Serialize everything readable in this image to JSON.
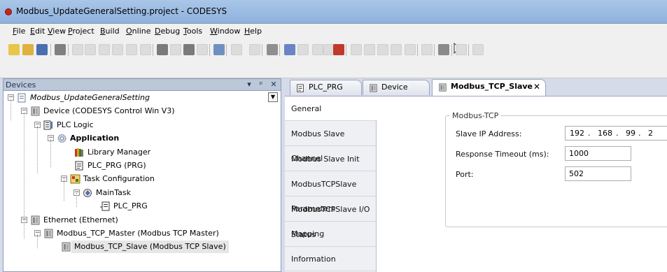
{
  "window": {
    "title": "Modbus_UpdateGeneralSetting.project - CODESYS",
    "accent": "#8fb1dc"
  },
  "menu": [
    {
      "label": "File",
      "u": "F",
      "rest": "ile"
    },
    {
      "label": "Edit",
      "u": "E",
      "rest": "dit"
    },
    {
      "label": "View",
      "u": "V",
      "rest": "iew"
    },
    {
      "label": "Project",
      "u": "P",
      "rest": "roject"
    },
    {
      "label": "Build",
      "u": "B",
      "rest": "uild"
    },
    {
      "label": "Online",
      "u": "O",
      "rest": "nline"
    },
    {
      "label": "Debug",
      "u": "D",
      "rest": "ebug"
    },
    {
      "label": "Tools",
      "u": "T",
      "rest": "ools"
    },
    {
      "label": "Window",
      "u": "W",
      "rest": "indow"
    },
    {
      "label": "Help",
      "u": "H",
      "rest": "elp"
    }
  ],
  "devices": {
    "title": "Devices",
    "pin_glyph": "▾",
    "tack_glyph": "ᵖ",
    "close_glyph": "✕",
    "tree": [
      {
        "label": "Modbus_UpdateGeneralSetting",
        "italic": true,
        "icon": "project-icon"
      },
      {
        "label": "Device (CODESYS Control Win V3)",
        "icon": "device-icon"
      },
      {
        "label": "PLC Logic",
        "icon": "plc-logic-icon"
      },
      {
        "label": "Application",
        "bold": true,
        "icon": "application-gear-icon"
      },
      {
        "label": "Library Manager",
        "icon": "library-books-icon"
      },
      {
        "label": "PLC_PRG (PRG)",
        "icon": "program-icon"
      },
      {
        "label": "Task Configuration",
        "icon": "task-config-icon"
      },
      {
        "label": "MainTask",
        "icon": "task-icon"
      },
      {
        "label": "PLC_PRG",
        "icon": "program-call-icon"
      },
      {
        "label": "Ethernet (Ethernet)",
        "icon": "device-icon"
      },
      {
        "label": "Modbus_TCP_Master (Modbus TCP Master)",
        "icon": "device-icon"
      },
      {
        "label": "Modbus_TCP_Slave (Modbus TCP Slave)",
        "icon": "device-icon",
        "selected": true
      }
    ]
  },
  "editor": {
    "tabs": [
      {
        "label": "PLC_PRG",
        "icon": "program-icon"
      },
      {
        "label": "Device",
        "icon": "device-icon"
      },
      {
        "label": "Modbus_TCP_Slave",
        "icon": "device-icon",
        "active": true,
        "close": "✕"
      }
    ],
    "side_tabs": [
      {
        "label": "General",
        "active": true
      },
      {
        "label": "Modbus Slave Channel"
      },
      {
        "label": "Modbus Slave Init"
      },
      {
        "label": "ModbusTCPSlave Parameters"
      },
      {
        "label": "ModbusTCPSlave I/O Mapping"
      },
      {
        "label": "Status"
      },
      {
        "label": "Information"
      }
    ],
    "group": {
      "legend": "Modbus-TCP",
      "slave_ip_label": "Slave IP Address:",
      "slave_ip": [
        "192",
        "168",
        "99",
        "2"
      ],
      "ip_dot": ".",
      "timeout_label": "Response Timeout (ms):",
      "timeout_value": "1000",
      "port_label": "Port:",
      "port_value": "502"
    }
  }
}
